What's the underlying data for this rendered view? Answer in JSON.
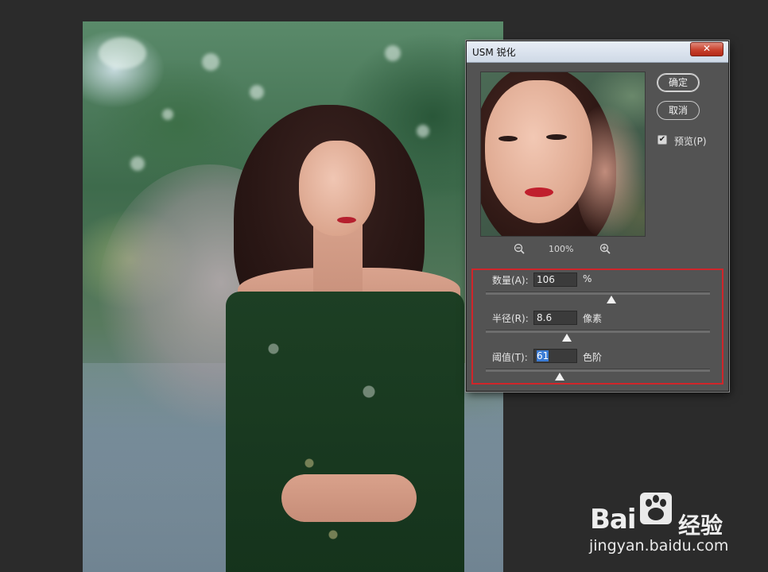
{
  "dialog": {
    "title": "USM 锐化",
    "close_label": "✕",
    "ok_label": "确定",
    "cancel_label": "取消",
    "preview_checkbox": {
      "label": "预览(P)",
      "checked": true
    },
    "zoom": {
      "level": "100%",
      "zoom_out_icon": "zoom-out-magnifier",
      "zoom_in_icon": "zoom-in-magnifier"
    },
    "params": {
      "amount": {
        "label": "数量(A):",
        "value": "106",
        "unit": "%",
        "slider_fraction": 0.56
      },
      "radius": {
        "label": "半径(R):",
        "value": "8.6",
        "unit": "像素",
        "slider_fraction": 0.36
      },
      "threshold": {
        "label": "阈值(T):",
        "value": "61",
        "unit": "色阶",
        "slider_fraction": 0.33
      }
    }
  },
  "highlight_color": "#d0252a",
  "watermark": {
    "brand": "Bai",
    "brand_cn": "经验",
    "url": "jingyan.baidu.com"
  }
}
